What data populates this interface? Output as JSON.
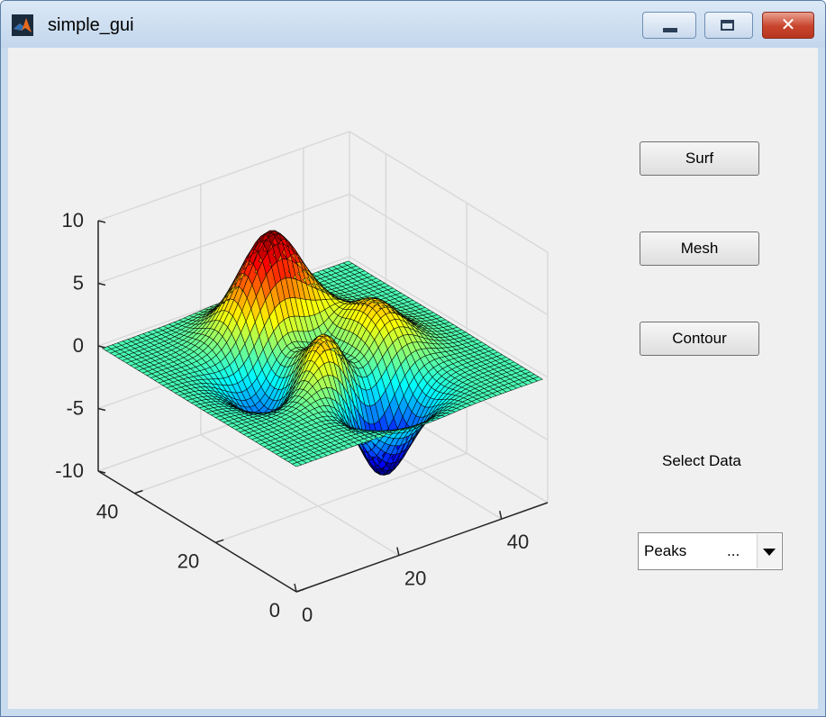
{
  "window": {
    "title": "simple_gui",
    "close_glyph": "✕"
  },
  "buttons": {
    "surf": "Surf",
    "mesh": "Mesh",
    "contour": "Contour"
  },
  "select_data": {
    "label": "Select Data",
    "value": "Peaks",
    "ellipsis": "..."
  },
  "chart_data": {
    "type": "surface",
    "function": "peaks",
    "grid_size": 49,
    "colormap": "jet",
    "x_ticks": [
      "0",
      "20",
      "40"
    ],
    "y_ticks": [
      "0",
      "20",
      "40"
    ],
    "z_ticks": [
      "10",
      "5",
      "0",
      "-5",
      "-10"
    ],
    "xlim": [
      0,
      49
    ],
    "ylim": [
      0,
      49
    ],
    "zlim": [
      -10,
      10
    ],
    "grid": true
  }
}
